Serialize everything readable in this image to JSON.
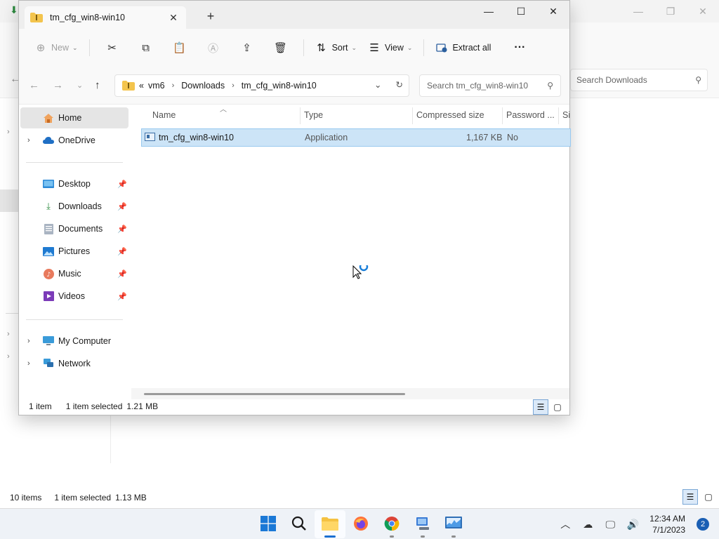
{
  "window": {
    "tab_title": "tm_cfg_win8-win10",
    "new_tab_symbol": "+",
    "close_tab_symbol": "✕"
  },
  "toolbar": {
    "new_label": "New",
    "sort_label": "Sort",
    "view_label": "View",
    "extract_all_label": "Extract all",
    "more_symbol": "···"
  },
  "address": {
    "overflow": "«",
    "crumbs": [
      "vm6",
      "Downloads",
      "tm_cfg_win8-win10"
    ]
  },
  "search": {
    "placeholder": "Search tm_cfg_win8-win10"
  },
  "nav": {
    "home": "Home",
    "onedrive": "OneDrive",
    "desktop": "Desktop",
    "downloads": "Downloads",
    "documents": "Documents",
    "pictures": "Pictures",
    "music": "Music",
    "videos": "Videos",
    "my_computer": "My Computer",
    "network": "Network"
  },
  "columns": {
    "name": "Name",
    "type": "Type",
    "compressed_size": "Compressed size",
    "password": "Password ...",
    "size": "Si"
  },
  "files": [
    {
      "name": "tm_cfg_win8-win10",
      "type": "Application",
      "compressed_size": "1,167 KB",
      "password": "No"
    }
  ],
  "status": {
    "item_count": "1 item",
    "selected": "1 item selected",
    "selected_size": "1.21 MB"
  },
  "background_window": {
    "search_placeholder": "Search Downloads",
    "item_count": "10 items",
    "selected": "1 item selected",
    "selected_size": "1.13 MB"
  },
  "taskbar": {
    "time": "12:34 AM",
    "date": "7/1/2023",
    "notification_count": "2"
  },
  "colors": {
    "selection_bg": "#cce4f7",
    "selection_border": "#99c9ef",
    "accent": "#1a6fd1",
    "taskbar_bg": "#eef2f7"
  }
}
